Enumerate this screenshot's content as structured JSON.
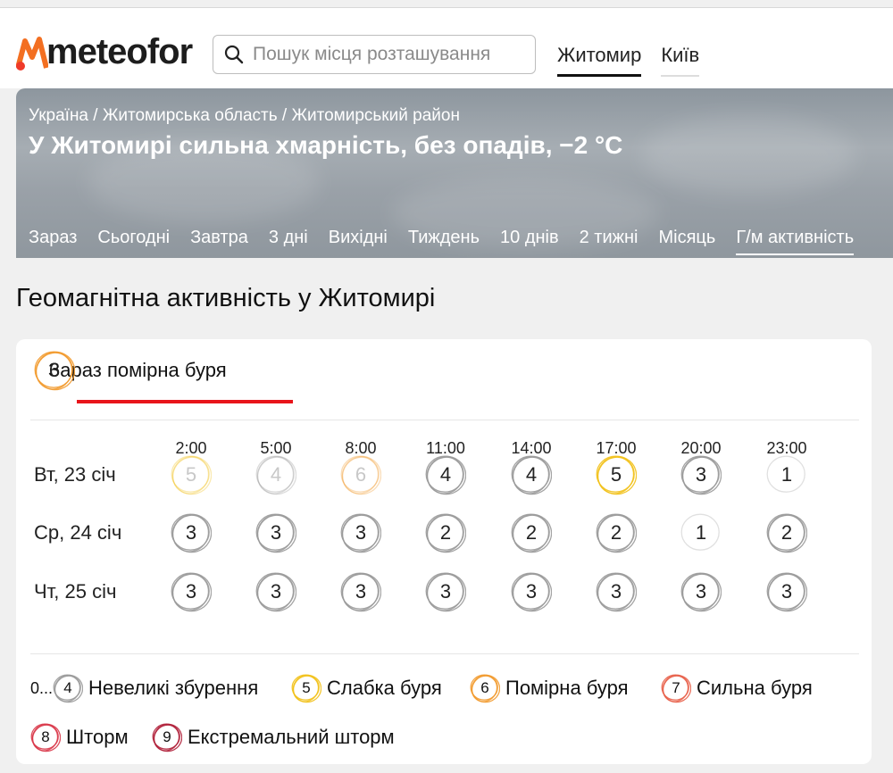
{
  "logo": {
    "text": "meteofor"
  },
  "search": {
    "placeholder": "Пошук місця розташування"
  },
  "city_tabs": [
    "Житомир",
    "Київ"
  ],
  "breadcrumb": "Україна / Житомирська область / Житомирський район",
  "headline": "У Житомирі сильна хмарність, без опадів, −2 °C",
  "nav": [
    "Зараз",
    "Сьогодні",
    "Завтра",
    "3 дні",
    "Вихідні",
    "Тиждень",
    "10 днів",
    "2 тижні",
    "Місяць",
    "Г/м активність"
  ],
  "page_title": "Геомагнітна активність у Житомирі",
  "current": {
    "value": "6",
    "label": "Зараз помірна буря"
  },
  "times": [
    "2:00",
    "5:00",
    "8:00",
    "11:00",
    "14:00",
    "17:00",
    "20:00",
    "23:00"
  ],
  "days": [
    {
      "label": "Вт, 23 січ",
      "values": [
        5,
        4,
        6,
        4,
        4,
        5,
        3,
        1
      ],
      "past": [
        true,
        true,
        true,
        false,
        false,
        false,
        false,
        false
      ]
    },
    {
      "label": "Ср, 24 січ",
      "values": [
        3,
        3,
        3,
        2,
        2,
        2,
        1,
        2
      ],
      "past": [
        false,
        false,
        false,
        false,
        false,
        false,
        false,
        false
      ]
    },
    {
      "label": "Чт, 25 січ",
      "values": [
        3,
        3,
        3,
        3,
        3,
        3,
        3,
        3
      ],
      "past": [
        false,
        false,
        false,
        false,
        false,
        false,
        false,
        false
      ]
    }
  ],
  "legend_prefix": "0...",
  "legend": [
    {
      "value": "4",
      "label": "Невеликі збурення",
      "color": "#9a9a9a"
    },
    {
      "value": "5",
      "label": "Слабка буря",
      "color": "#f2c11a"
    },
    {
      "value": "6",
      "label": "Помірна буря",
      "color": "#f29a2e"
    },
    {
      "value": "7",
      "label": "Сильна буря",
      "color": "#e8604a"
    },
    {
      "value": "8",
      "label": "Шторм",
      "color": "#d9384a"
    },
    {
      "value": "9",
      "label": "Екстремальний шторм",
      "color": "#b0203a"
    }
  ],
  "colors": {
    "accent": "#e8141a",
    "logo_orange": "#f36f21"
  }
}
